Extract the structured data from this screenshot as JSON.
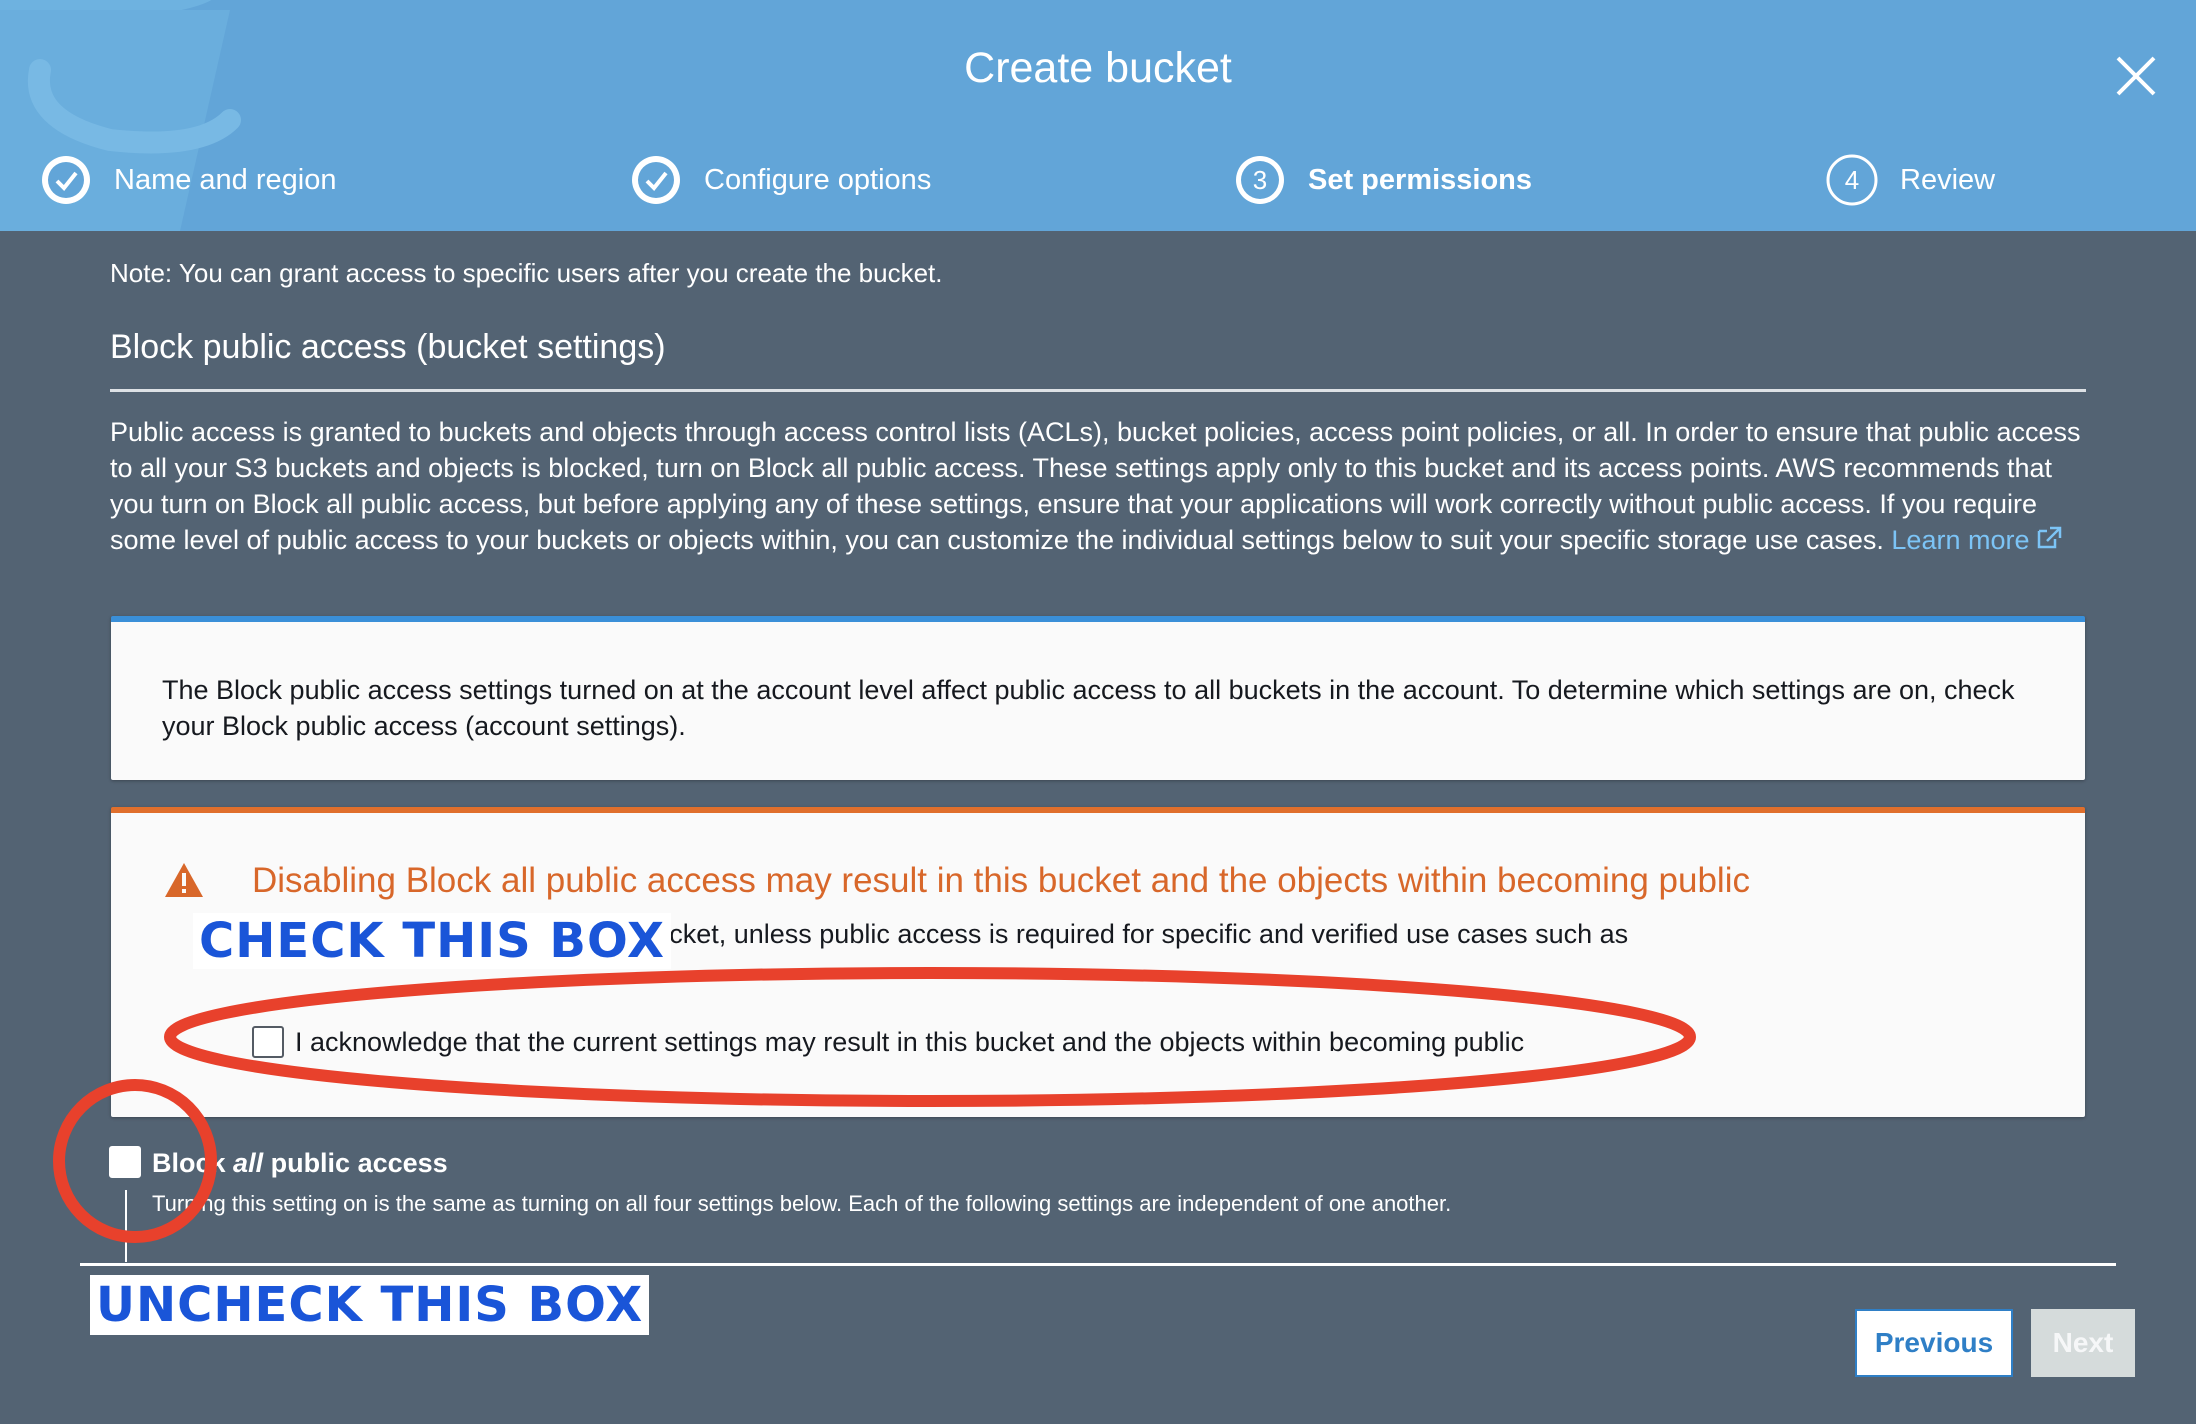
{
  "window": {
    "title": "Create bucket",
    "close_icon": "close-icon"
  },
  "steps": [
    {
      "label": "Name and region",
      "state": "done",
      "number": ""
    },
    {
      "label": "Configure options",
      "state": "done",
      "number": ""
    },
    {
      "label": "Set permissions",
      "state": "active",
      "number": "3"
    },
    {
      "label": "Review",
      "state": "pending",
      "number": "4"
    }
  ],
  "main": {
    "note": "Note: You can grant access to specific users after you create the bucket.",
    "section_title": "Block public access (bucket settings)",
    "description": "Public access is granted to buckets and objects through access control lists (ACLs), bucket policies, access point policies, or all. In order to ensure that public access to all your S3 buckets and objects is blocked, turn on Block all public access. These settings apply only to this bucket and its access points. AWS recommends that you turn on Block all public access, but before applying any of these settings, ensure that your applications will work correctly without public access. If you require some level of public access to your buckets or objects within, you can customize the individual settings below to suit your specific storage use cases.",
    "learn_more": "Learn more",
    "info_box": "The Block public access settings turned on at the account level affect public access to all buckets in the account. To determine which settings are on, check your Block public access (account settings).",
    "warning": {
      "title": "Disabling Block all public access may result in this bucket and the objects within becoming public",
      "body": "u block all public access to your bucket, unless public access is required for specific and verified use cases such as",
      "ack_label": "I acknowledge that the current settings may result in this bucket and the objects within becoming public",
      "ack_checked": false
    },
    "block_all": {
      "label_prefix": "Bloc",
      "label_hidden": "k ",
      "label_italic": "all",
      "label_suffix": " public access",
      "description": "Turning this setting on is the same as turning on all four settings below. Each of the following settings are independent of one another.",
      "checked": false
    }
  },
  "footer": {
    "previous": "Previous",
    "next": "Next"
  },
  "annotations": {
    "check_this_box": "CHECK THIS BOX",
    "uncheck_this_box": "UNCHECK THIS BOX",
    "color": "#e8412c"
  },
  "colors": {
    "header": "#62a5d8",
    "background": "#536373",
    "info_accent": "#3a8fd8",
    "warning_accent": "#e06f2c",
    "link": "#7cc4f6"
  }
}
